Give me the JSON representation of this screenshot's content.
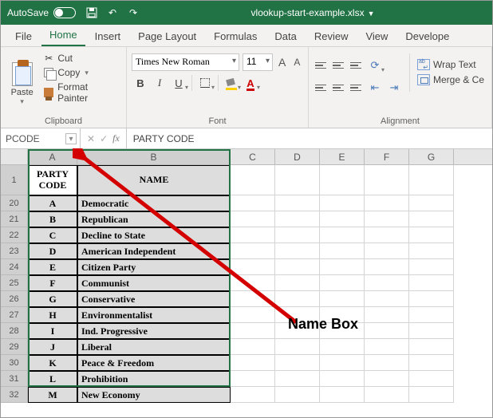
{
  "titlebar": {
    "autosave_label": "AutoSave",
    "filename": "vlookup-start-example.xlsx"
  },
  "tabs": [
    "File",
    "Home",
    "Insert",
    "Page Layout",
    "Formulas",
    "Data",
    "Review",
    "View",
    "Develope"
  ],
  "active_tab": "Home",
  "ribbon": {
    "clipboard": {
      "label": "Clipboard",
      "paste": "Paste",
      "cut": "Cut",
      "copy": "Copy",
      "format_painter": "Format Painter"
    },
    "font": {
      "label": "Font",
      "font_name": "Times New Roman",
      "font_size": "11",
      "bold": "B",
      "italic": "I",
      "underline": "U",
      "fontcolor_letter": "A",
      "increaseA": "A",
      "decreaseA": "A"
    },
    "alignment": {
      "label": "Alignment",
      "wrap_text": "Wrap Text",
      "merge_center": "Merge & Ce"
    }
  },
  "formula_bar": {
    "name_box": "PCODE",
    "cancel": "✕",
    "enter": "✓",
    "fx": "fx",
    "formula_value": "PARTY CODE"
  },
  "columns": [
    "A",
    "B",
    "C",
    "D",
    "E",
    "F",
    "G"
  ],
  "header_row_num": "1",
  "table": {
    "headers": {
      "code": "PARTY\nCODE",
      "name": "NAME"
    },
    "rows": [
      {
        "num": "20",
        "code": "A",
        "name": "Democratic"
      },
      {
        "num": "21",
        "code": "B",
        "name": "Republican"
      },
      {
        "num": "22",
        "code": "C",
        "name": "Decline to State"
      },
      {
        "num": "23",
        "code": "D",
        "name": "American Independent"
      },
      {
        "num": "24",
        "code": "E",
        "name": "Citizen Party"
      },
      {
        "num": "25",
        "code": "F",
        "name": "Communist"
      },
      {
        "num": "26",
        "code": "G",
        "name": "Conservative"
      },
      {
        "num": "27",
        "code": "H",
        "name": "Environmentalist"
      },
      {
        "num": "28",
        "code": "I",
        "name": "Ind. Progressive"
      },
      {
        "num": "29",
        "code": "J",
        "name": "Liberal"
      },
      {
        "num": "30",
        "code": "K",
        "name": "Peace & Freedom"
      },
      {
        "num": "31",
        "code": "L",
        "name": "Prohibition"
      },
      {
        "num": "32",
        "code": "M",
        "name": "New Economy"
      }
    ]
  },
  "annotation": "Name Box"
}
